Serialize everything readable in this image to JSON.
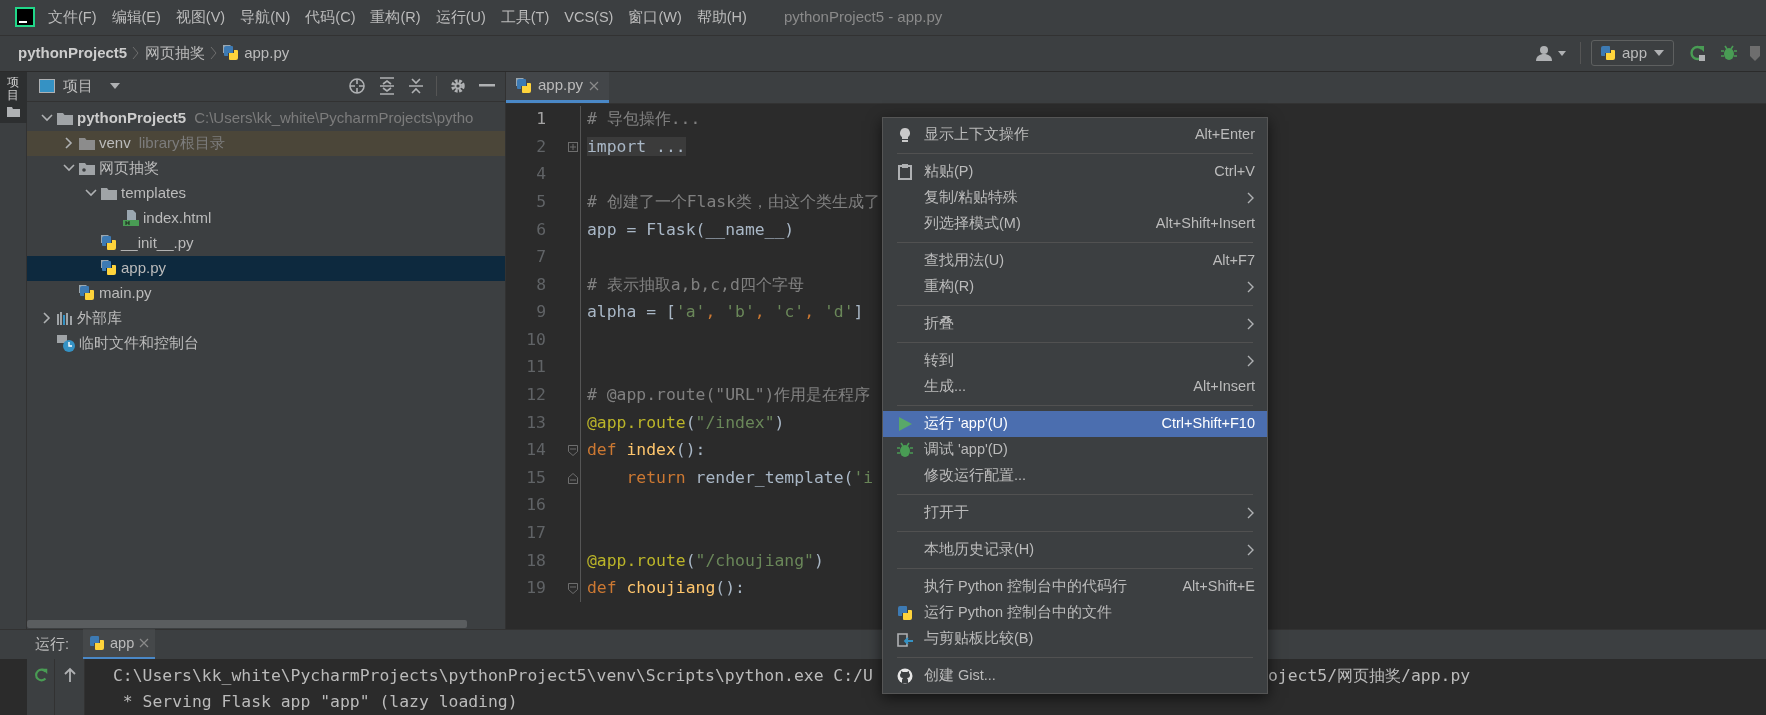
{
  "window": {
    "title": "pythonProject5 - app.py"
  },
  "main_menu": [
    "文件(F)",
    "编辑(E)",
    "视图(V)",
    "导航(N)",
    "代码(C)",
    "重构(R)",
    "运行(U)",
    "工具(T)",
    "VCS(S)",
    "窗口(W)",
    "帮助(H)"
  ],
  "breadcrumb": [
    {
      "kind": "project",
      "label": "pythonProject5"
    },
    {
      "kind": "folder",
      "label": "网页抽奖"
    },
    {
      "kind": "python",
      "label": "app.py"
    }
  ],
  "run_config": {
    "label": "app"
  },
  "side_strip": {
    "label": "项目"
  },
  "project_panel": {
    "title": "项目",
    "tree": [
      {
        "kind": "root",
        "label": "pythonProject5",
        "hint": "C:\\Users\\kk_white\\PycharmProjects\\pytho",
        "expanded": true,
        "selected": false,
        "children": [
          {
            "kind": "excluded",
            "label": "venv",
            "hint": "library根目录",
            "expanded": false,
            "selected": false
          },
          {
            "kind": "package",
            "label": "网页抽奖",
            "expanded": true,
            "selected": false,
            "children": [
              {
                "kind": "folder",
                "label": "templates",
                "expanded": true,
                "selected": false,
                "children": [
                  {
                    "kind": "html",
                    "label": "index.html",
                    "selected": false
                  }
                ]
              },
              {
                "kind": "python",
                "label": "__init__.py",
                "selected": false
              },
              {
                "kind": "python",
                "label": "app.py",
                "selected": true
              }
            ]
          },
          {
            "kind": "python",
            "label": "main.py",
            "selected": false
          }
        ]
      },
      {
        "kind": "library",
        "label": "外部库",
        "expanded": false,
        "selected": false
      },
      {
        "kind": "scratch",
        "label": "临时文件和控制台",
        "selected": false
      }
    ]
  },
  "editor": {
    "tabs": [
      {
        "label": "app.py",
        "selected": true
      }
    ],
    "lines": [
      {
        "number": "1",
        "current": true,
        "tokens": [
          {
            "kind": "comment",
            "text": "# 导包操作..."
          }
        ]
      },
      {
        "number": "2",
        "current": false,
        "kind": "folded",
        "tokens": [
          {
            "kind": "folded",
            "text": "import ..."
          }
        ]
      },
      {
        "number": "4",
        "current": false
      },
      {
        "number": "5",
        "current": false,
        "tokens": [
          {
            "kind": "comment",
            "text": "# 创建了一个Flask类，由这个类生成了"
          }
        ]
      },
      {
        "number": "6",
        "current": false,
        "tokens": [
          {
            "kind": "plain",
            "text": "app = Flask(__name__)"
          }
        ]
      },
      {
        "number": "7",
        "current": false
      },
      {
        "number": "8",
        "current": false,
        "tokens": [
          {
            "kind": "comment",
            "text": "# 表示抽取a,b,c,d四个字母"
          }
        ]
      },
      {
        "number": "9",
        "current": false,
        "tokens": [
          {
            "kind": "plain",
            "text": "alpha = ["
          },
          {
            "kind": "string",
            "text": "'a'"
          },
          {
            "kind": "punct",
            "text": ", "
          },
          {
            "kind": "string",
            "text": "'b'"
          },
          {
            "kind": "punct",
            "text": ", "
          },
          {
            "kind": "string",
            "text": "'c'"
          },
          {
            "kind": "punct",
            "text": ", "
          },
          {
            "kind": "string",
            "text": "'d'"
          },
          {
            "kind": "plain",
            "text": "]"
          }
        ]
      },
      {
        "number": "10",
        "current": false
      },
      {
        "number": "11",
        "current": false
      },
      {
        "number": "12",
        "current": false,
        "tokens": [
          {
            "kind": "comment",
            "text": "# @app.route(\"URL\")作用是在程序"
          }
        ]
      },
      {
        "number": "13",
        "current": false,
        "tokens": [
          {
            "kind": "decorator",
            "text": "@app.route"
          },
          {
            "kind": "plain",
            "text": "("
          },
          {
            "kind": "string",
            "text": "\"/index\""
          },
          {
            "kind": "plain",
            "text": ")"
          }
        ]
      },
      {
        "number": "14",
        "current": false,
        "kind": "block-start",
        "tokens": [
          {
            "kind": "keyword",
            "text": "def "
          },
          {
            "kind": "function",
            "text": "index"
          },
          {
            "kind": "plain",
            "text": "():"
          }
        ]
      },
      {
        "number": "15",
        "current": false,
        "kind": "block-end",
        "tokens": [
          {
            "kind": "keyword",
            "text": "    return"
          },
          {
            "kind": "plain",
            "text": " render_template("
          },
          {
            "kind": "string",
            "text": "'i"
          }
        ]
      },
      {
        "number": "16",
        "current": false
      },
      {
        "number": "17",
        "current": false
      },
      {
        "number": "18",
        "current": false,
        "tokens": [
          {
            "kind": "decorator",
            "text": "@app.route"
          },
          {
            "kind": "plain",
            "text": "("
          },
          {
            "kind": "string",
            "text": "\"/choujiang\""
          },
          {
            "kind": "plain",
            "text": ")"
          }
        ]
      },
      {
        "number": "19",
        "current": false,
        "kind": "block-start",
        "tokens": [
          {
            "kind": "keyword",
            "text": "def "
          },
          {
            "kind": "function",
            "text": "choujiang"
          },
          {
            "kind": "plain",
            "text": "():"
          }
        ]
      }
    ]
  },
  "context_menu": [
    [
      {
        "kind": "bulb",
        "label": "显示上下文操作",
        "shortcut": "Alt+Enter",
        "selected": false
      }
    ],
    [
      {
        "kind": "clipboard",
        "label": "粘贴(P)",
        "shortcut": "Ctrl+V",
        "selected": false
      },
      {
        "label": "复制/粘贴特殊",
        "submenu": true,
        "selected": false
      },
      {
        "label": "列选择模式(M)",
        "shortcut": "Alt+Shift+Insert",
        "selected": false
      }
    ],
    [
      {
        "label": "查找用法(U)",
        "shortcut": "Alt+F7",
        "selected": false
      },
      {
        "label": "重构(R)",
        "submenu": true,
        "selected": false
      }
    ],
    [
      {
        "label": "折叠",
        "submenu": true,
        "selected": false
      }
    ],
    [
      {
        "label": "转到",
        "submenu": true,
        "selected": false
      },
      {
        "label": "生成...",
        "shortcut": "Alt+Insert",
        "selected": false
      }
    ],
    [
      {
        "kind": "play",
        "label": "运行 'app'(U)",
        "shortcut": "Ctrl+Shift+F10",
        "selected": true
      },
      {
        "kind": "bug",
        "label": "调试 'app'(D)",
        "selected": false
      },
      {
        "label": "修改运行配置...",
        "selected": false
      }
    ],
    [
      {
        "label": "打开于",
        "submenu": true,
        "selected": false
      }
    ],
    [
      {
        "label": "本地历史记录(H)",
        "submenu": true,
        "selected": false
      }
    ],
    [
      {
        "label": "执行 Python 控制台中的代码行",
        "shortcut": "Alt+Shift+E",
        "selected": false
      },
      {
        "kind": "python",
        "label": "运行 Python 控制台中的文件",
        "selected": false
      },
      {
        "kind": "compare",
        "label": "与剪贴板比较(B)",
        "selected": false
      }
    ],
    [
      {
        "kind": "github",
        "label": "创建 Gist...",
        "selected": false
      }
    ]
  ],
  "run_panel": {
    "title": "运行:",
    "tabs": [
      {
        "label": "app",
        "selected": true
      }
    ],
    "console": [
      {
        "segments": [
          "C:\\Users\\kk_white\\PycharmProjects\\pythonProject5\\venv\\Scripts\\python.exe C:/U",
          "oject5/网页抽奖/app.py"
        ]
      },
      {
        "segments": [
          " * Serving Flask app \"app\" (lazy loading)"
        ]
      }
    ]
  }
}
